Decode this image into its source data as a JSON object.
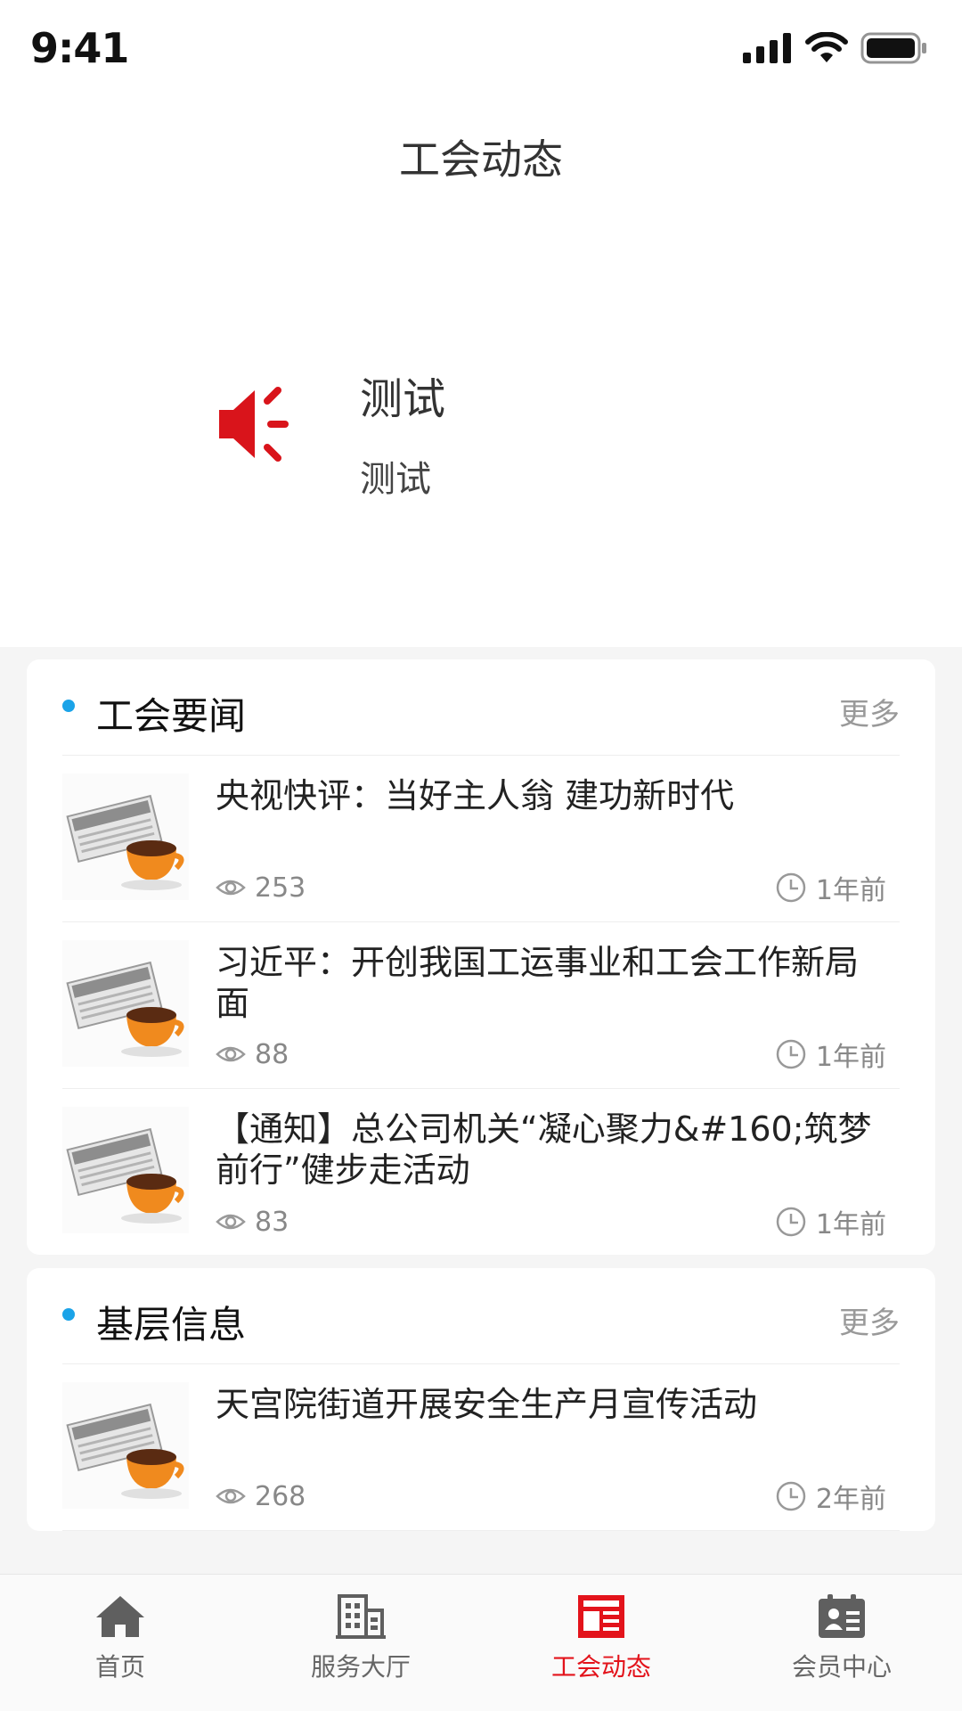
{
  "status_bar": {
    "time": "9:41"
  },
  "header": {
    "title": "工会动态"
  },
  "notice": {
    "icon": "speaker-icon",
    "title": "测试",
    "subtitle": "测试"
  },
  "sections": [
    {
      "title": "工会要闻",
      "more": "更多",
      "items": [
        {
          "title": "央视快评：当好主人翁 建功新时代",
          "views": "253",
          "time": "1年前"
        },
        {
          "title": "习近平：开创我国工运事业和工会工作新局面",
          "views": "88",
          "time": "1年前"
        },
        {
          "title": "【通知】总公司机关“凝心聚力&#160;筑梦前行”健步走活动",
          "views": "83",
          "time": "1年前"
        }
      ]
    },
    {
      "title": "基层信息",
      "more": "更多",
      "items": [
        {
          "title": "天宫院街道开展安全生产月宣传活动",
          "views": "268",
          "time": "2年前"
        }
      ]
    }
  ],
  "tabbar": {
    "active_color": "#e3131b",
    "items": [
      {
        "label": "首页",
        "icon": "home-icon"
      },
      {
        "label": "服务大厅",
        "icon": "building-icon"
      },
      {
        "label": "工会动态",
        "icon": "news-icon"
      },
      {
        "label": "会员中心",
        "icon": "member-card-icon"
      }
    ]
  },
  "colors": {
    "accent_dot": "#1aa3e8",
    "active_tab": "#e3131b",
    "notice_icon": "#d9141b"
  }
}
